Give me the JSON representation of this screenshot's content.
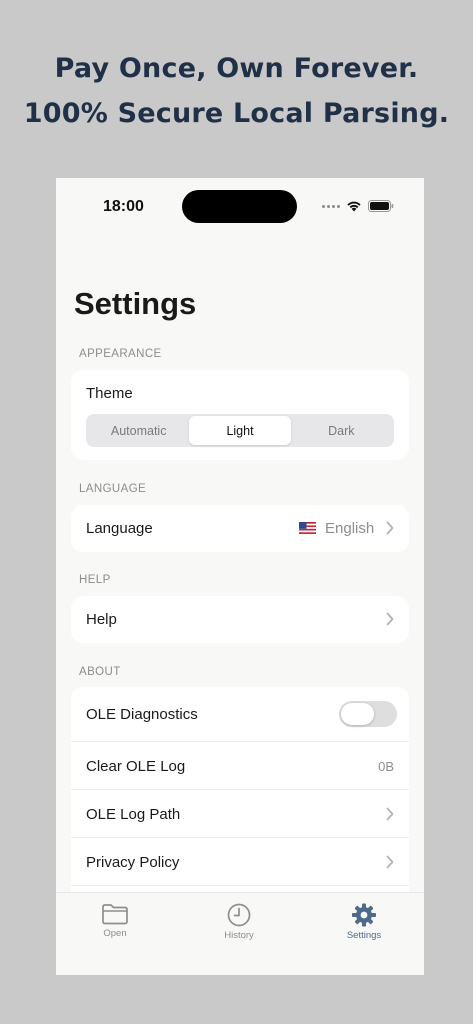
{
  "promo": {
    "line1": "Pay Once, Own Forever.",
    "line2": "100% Secure Local Parsing."
  },
  "status_bar": {
    "time": "18:00",
    "icons": [
      "signal-dots-icon",
      "wifi-icon",
      "battery-icon"
    ]
  },
  "page": {
    "title": "Settings"
  },
  "appearance": {
    "section_label": "APPEARANCE",
    "theme_label": "Theme",
    "options": [
      "Automatic",
      "Light",
      "Dark"
    ],
    "selected": "Light"
  },
  "language": {
    "section_label": "LANGUAGE",
    "row_label": "Language",
    "value": "English",
    "flag_icon": "us-flag-icon"
  },
  "help": {
    "section_label": "HELP",
    "row_label": "Help"
  },
  "about": {
    "section_label": "ABOUT",
    "rows": {
      "diagnostics": {
        "label": "OLE Diagnostics",
        "toggle_on": false
      },
      "clear_log": {
        "label": "Clear OLE Log",
        "value": "0B"
      },
      "log_path": {
        "label": "OLE Log Path"
      },
      "privacy": {
        "label": "Privacy Policy"
      }
    }
  },
  "tabbar": {
    "tabs": [
      {
        "label": "Open",
        "icon": "folder-icon",
        "active": false
      },
      {
        "label": "History",
        "icon": "clock-icon",
        "active": false
      },
      {
        "label": "Settings",
        "icon": "gear-icon",
        "active": true
      }
    ]
  },
  "colors": {
    "background": "#c9c9c9",
    "headline": "#1f3047",
    "tab_active": "#4d6a8d",
    "tab_inactive": "#8e8e8e"
  }
}
